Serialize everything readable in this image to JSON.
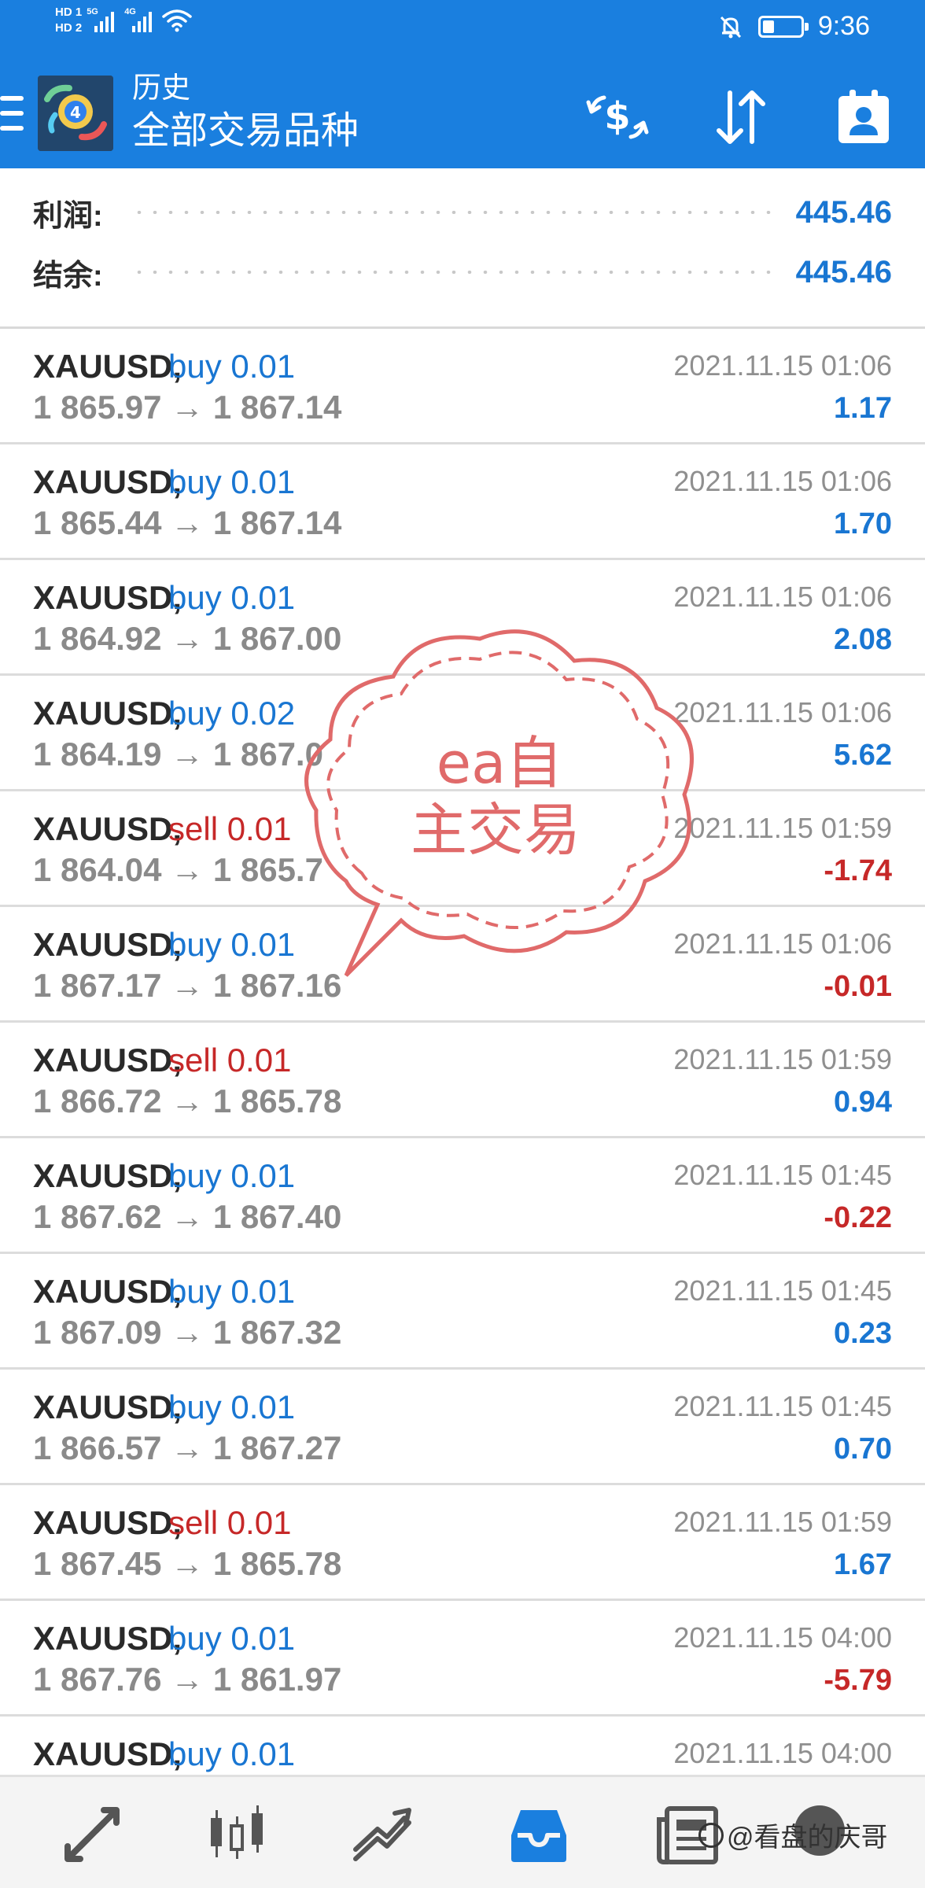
{
  "status_bar": {
    "hd1": "HD 1",
    "hd2": "HD 2",
    "net1": "5G",
    "net2": "4G",
    "time": "9:36"
  },
  "header": {
    "title_small": "历史",
    "title_big": "全部交易品种",
    "icons": [
      "menu-icon",
      "mt4-logo",
      "currency-exchange-icon",
      "sort-icon",
      "contact-card-icon"
    ]
  },
  "summary": {
    "profit_label": "利润:",
    "profit_value": "445.46",
    "balance_label": "结余:",
    "balance_value": "445.46"
  },
  "trades": [
    {
      "symbol": "XAUUSD,",
      "action": "buy 0.01",
      "side": "buy",
      "prices": "1 865.97 → 1 867.14",
      "time": "2021.11.15 01:06",
      "profit": "1.17",
      "sign": "pos"
    },
    {
      "symbol": "XAUUSD,",
      "action": "buy 0.01",
      "side": "buy",
      "prices": "1 865.44 → 1 867.14",
      "time": "2021.11.15 01:06",
      "profit": "1.70",
      "sign": "pos"
    },
    {
      "symbol": "XAUUSD,",
      "action": "buy 0.01",
      "side": "buy",
      "prices": "1 864.92 → 1 867.00",
      "time": "2021.11.15 01:06",
      "profit": "2.08",
      "sign": "pos"
    },
    {
      "symbol": "XAUUSD,",
      "action": "buy 0.02",
      "side": "buy",
      "prices": "1 864.19 → 1 867.0",
      "time": "2021.11.15 01:06",
      "profit": "5.62",
      "sign": "pos"
    },
    {
      "symbol": "XAUUSD,",
      "action": "sell 0.01",
      "side": "sell",
      "prices": "1 864.04 → 1 865.7",
      "time": "2021.11.15 01:59",
      "profit": "-1.74",
      "sign": "neg"
    },
    {
      "symbol": "XAUUSD,",
      "action": "buy 0.01",
      "side": "buy",
      "prices": "1 867.17 → 1 867.16",
      "time": "2021.11.15 01:06",
      "profit": "-0.01",
      "sign": "neg"
    },
    {
      "symbol": "XAUUSD,",
      "action": "sell 0.01",
      "side": "sell",
      "prices": "1 866.72 → 1 865.78",
      "time": "2021.11.15 01:59",
      "profit": "0.94",
      "sign": "pos"
    },
    {
      "symbol": "XAUUSD,",
      "action": "buy 0.01",
      "side": "buy",
      "prices": "1 867.62 → 1 867.40",
      "time": "2021.11.15 01:45",
      "profit": "-0.22",
      "sign": "neg"
    },
    {
      "symbol": "XAUUSD,",
      "action": "buy 0.01",
      "side": "buy",
      "prices": "1 867.09 → 1 867.32",
      "time": "2021.11.15 01:45",
      "profit": "0.23",
      "sign": "pos"
    },
    {
      "symbol": "XAUUSD,",
      "action": "buy 0.01",
      "side": "buy",
      "prices": "1 866.57 → 1 867.27",
      "time": "2021.11.15 01:45",
      "profit": "0.70",
      "sign": "pos"
    },
    {
      "symbol": "XAUUSD,",
      "action": "sell 0.01",
      "side": "sell",
      "prices": "1 867.45 → 1 865.78",
      "time": "2021.11.15 01:59",
      "profit": "1.67",
      "sign": "pos"
    },
    {
      "symbol": "XAUUSD,",
      "action": "buy 0.01",
      "side": "buy",
      "prices": "1 867.76 → 1 861.97",
      "time": "2021.11.15 04:00",
      "profit": "-5.79",
      "sign": "neg"
    },
    {
      "symbol": "XAUUSD,",
      "action": "buy 0.01",
      "side": "buy",
      "prices": "",
      "time": "2021.11.15 04:00",
      "profit": "",
      "sign": "pos"
    }
  ],
  "stamp": {
    "line1": "ea自",
    "line2": "主交易",
    "color": "#e06a6a"
  },
  "bottom_nav": {
    "items": [
      "quotes-icon",
      "chart-icon",
      "trade-icon",
      "history-icon",
      "news-icon"
    ],
    "active": "history-icon"
  },
  "watermark": "@看盘的庆哥",
  "colors": {
    "header_blue": "#1a7fdf",
    "positive": "#1976d2",
    "negative": "#c62828"
  }
}
